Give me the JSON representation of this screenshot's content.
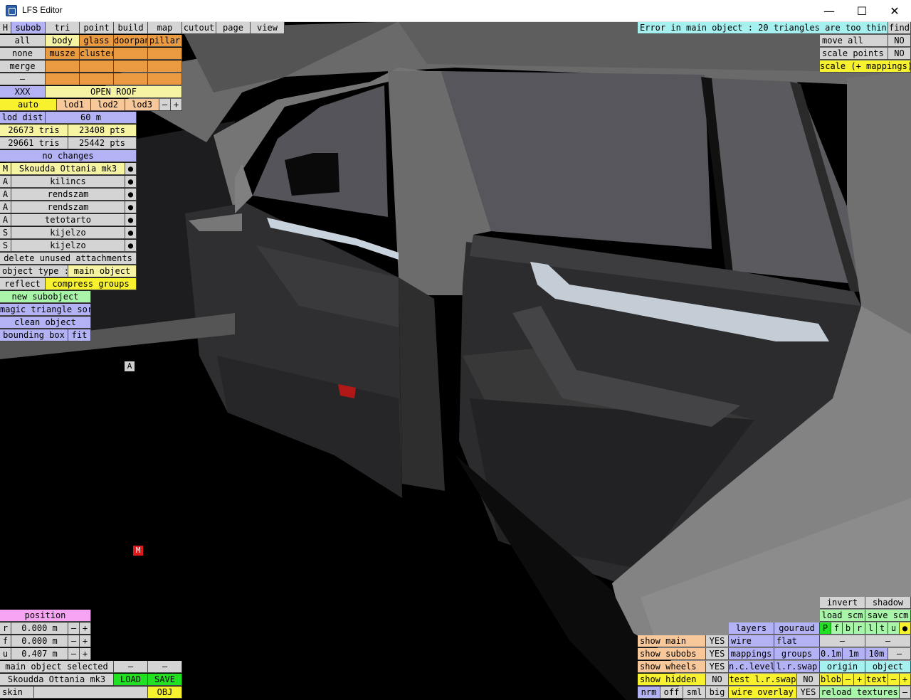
{
  "window": {
    "title": "LFS Editor",
    "minimize": "—",
    "maximize": "☐",
    "close": "✕"
  },
  "top_bar": {
    "h": "H",
    "subob": "subob",
    "tri": "tri",
    "point": "point",
    "build": "build",
    "map": "map",
    "cutout": "cutout",
    "page": "page",
    "view": "view"
  },
  "error_message": "Error in main object : 20 triangles are too thin",
  "find": "find",
  "right_top": {
    "move_all": "move all",
    "move_all_value": "NO",
    "scale_points": "scale points",
    "scale_points_value": "NO",
    "scale_mappings": "scale (+ mappings)"
  },
  "left_panel": {
    "all": "all",
    "none": "none",
    "merge": "merge",
    "dash": "–",
    "xxx": "XXX",
    "groups": [
      "body",
      "glass",
      "doorpan",
      "pillar",
      "musze",
      "cluster"
    ],
    "open_roof": "OPEN ROOF",
    "auto": "auto",
    "lod1": "lod1",
    "lod2": "lod2",
    "lod3": "lod3",
    "minus": "–",
    "plus": "+",
    "lod_dist_label": "lod dist",
    "lod_dist_value": "60 m",
    "tris_1": "26673 tris",
    "pts_1": "23408 pts",
    "tris_2": "29661 tris",
    "pts_2": "25442 pts",
    "no_changes": "no changes",
    "objects": [
      {
        "tag": "M",
        "name": "Skoudda Ottania mk3",
        "dot": "●"
      },
      {
        "tag": "A",
        "name": "kilincs",
        "dot": "●"
      },
      {
        "tag": "A",
        "name": "rendszam",
        "dot": "●"
      },
      {
        "tag": "A",
        "name": "rendszam",
        "dot": "●"
      },
      {
        "tag": "A",
        "name": "tetotarto",
        "dot": "●"
      },
      {
        "tag": "S",
        "name": "kijelzo",
        "dot": "●"
      },
      {
        "tag": "S",
        "name": "kijelzo",
        "dot": "●"
      }
    ],
    "delete_unused": "delete unused attachments",
    "object_type_label": "object type :",
    "object_type_value": "main object",
    "reflect": "reflect",
    "compress_groups": "compress groups",
    "new_subobject": "new subobject",
    "magic_sort": "magic triangle sort",
    "clean_object": "clean object",
    "bounding_box": "bounding box",
    "fit": "fit"
  },
  "markers": {
    "a": "A",
    "m": "M"
  },
  "position_panel": {
    "title": "position",
    "rows": [
      {
        "axis": "r",
        "value": "0.000 m",
        "minus": "–",
        "plus": "+"
      },
      {
        "axis": "f",
        "value": "0.000 m",
        "minus": "–",
        "plus": "+"
      },
      {
        "axis": "u",
        "value": "0.407 m",
        "minus": "–",
        "plus": "+"
      }
    ],
    "selected": "main object selected",
    "dash1": "–",
    "dash2": "–",
    "obj_name": "Skoudda Ottania mk3",
    "load": "LOAD",
    "save": "SAVE",
    "skin": "skin",
    "obj": "OBJ"
  },
  "bottom_right": {
    "show_main": "show main",
    "show_main_value": "YES",
    "show_subobs": "show subobs",
    "show_subobs_value": "YES",
    "show_wheels": "show wheels",
    "show_wheels_value": "YES",
    "show_hidden": "show hidden",
    "show_hidden_value": "NO",
    "nrm": "nrm",
    "off": "off",
    "sml": "sml",
    "big": "big",
    "layers": "layers",
    "gouraud": "gouraud",
    "wire": "wire",
    "flat": "flat",
    "mappings": "mappings",
    "groups": "groups",
    "nclevel": "n.c.level",
    "lrswap": "l.r.swap",
    "test_lrswap": "test l.r.swap",
    "test_lrswap_value": "NO",
    "wire_overlay": "wire overlay",
    "wire_overlay_value": "YES",
    "invert": "invert",
    "shadow": "shadow",
    "load_scm": "load scm",
    "save_scm": "save scm",
    "pfbrltu": [
      "P",
      "f",
      "b",
      "r",
      "l",
      "t",
      "u"
    ],
    "dot": "●",
    "dash_a": "–",
    "dash_b": "–",
    "step_01": "0.1m",
    "step_1": "1m",
    "step_10": "10m",
    "step_minus": "–",
    "origin": "origin",
    "object": "object",
    "blob": "blob",
    "blob_minus": "–",
    "blob_plus": "+",
    "text": "text",
    "text_minus": "–",
    "text_plus": "+",
    "reload_textures": "reload textures",
    "reload_minus": "–"
  }
}
